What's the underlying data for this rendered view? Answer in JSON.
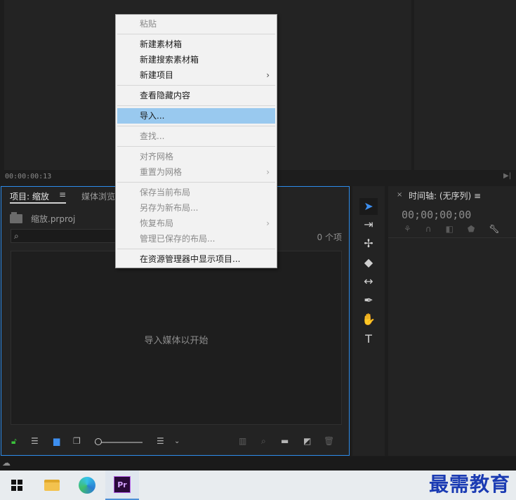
{
  "source_monitor": {
    "timecode": "00:00:00:13"
  },
  "project_panel": {
    "tab_project": "项目: 缩放",
    "tab_menu_glyph": "≡",
    "tab_media": "媒体浏览",
    "file_name": "缩放.prproj",
    "search_placeholder": "",
    "item_count": "0 个项",
    "empty_hint": "导入媒体以开始"
  },
  "timeline_panel": {
    "close_glyph": "×",
    "title": "时间轴: (无序列) ≡",
    "timecode": "00;00;00;00"
  },
  "context_menu": {
    "items": [
      {
        "label": "粘贴",
        "disabled": true
      },
      {
        "sep": true
      },
      {
        "label": "新建素材箱",
        "disabled": false
      },
      {
        "label": "新建搜索素材箱",
        "disabled": false
      },
      {
        "label": "新建项目",
        "disabled": false,
        "submenu": true
      },
      {
        "sep": true
      },
      {
        "label": "查看隐藏内容",
        "disabled": false
      },
      {
        "sep": true
      },
      {
        "label": "导入...",
        "disabled": false,
        "highlight": true
      },
      {
        "sep": true
      },
      {
        "label": "查找...",
        "disabled": true
      },
      {
        "sep": true
      },
      {
        "label": "对齐网格",
        "disabled": true
      },
      {
        "label": "重置为网格",
        "disabled": true,
        "submenu": true
      },
      {
        "sep": true
      },
      {
        "label": "保存当前布局",
        "disabled": true
      },
      {
        "label": "另存为新布局...",
        "disabled": true
      },
      {
        "label": "恢复布局",
        "disabled": true,
        "submenu": true
      },
      {
        "label": "管理已保存的布局...",
        "disabled": true
      },
      {
        "sep": true
      },
      {
        "label": "在资源管理器中显示项目...",
        "disabled": false
      }
    ]
  },
  "taskbar": {
    "premiere_label": "Pr",
    "watermark": "最需教育"
  },
  "colors": {
    "accent_blue": "#2d8ceb",
    "menu_highlight": "#99c9ef",
    "watermark": "#1b3bb3"
  }
}
